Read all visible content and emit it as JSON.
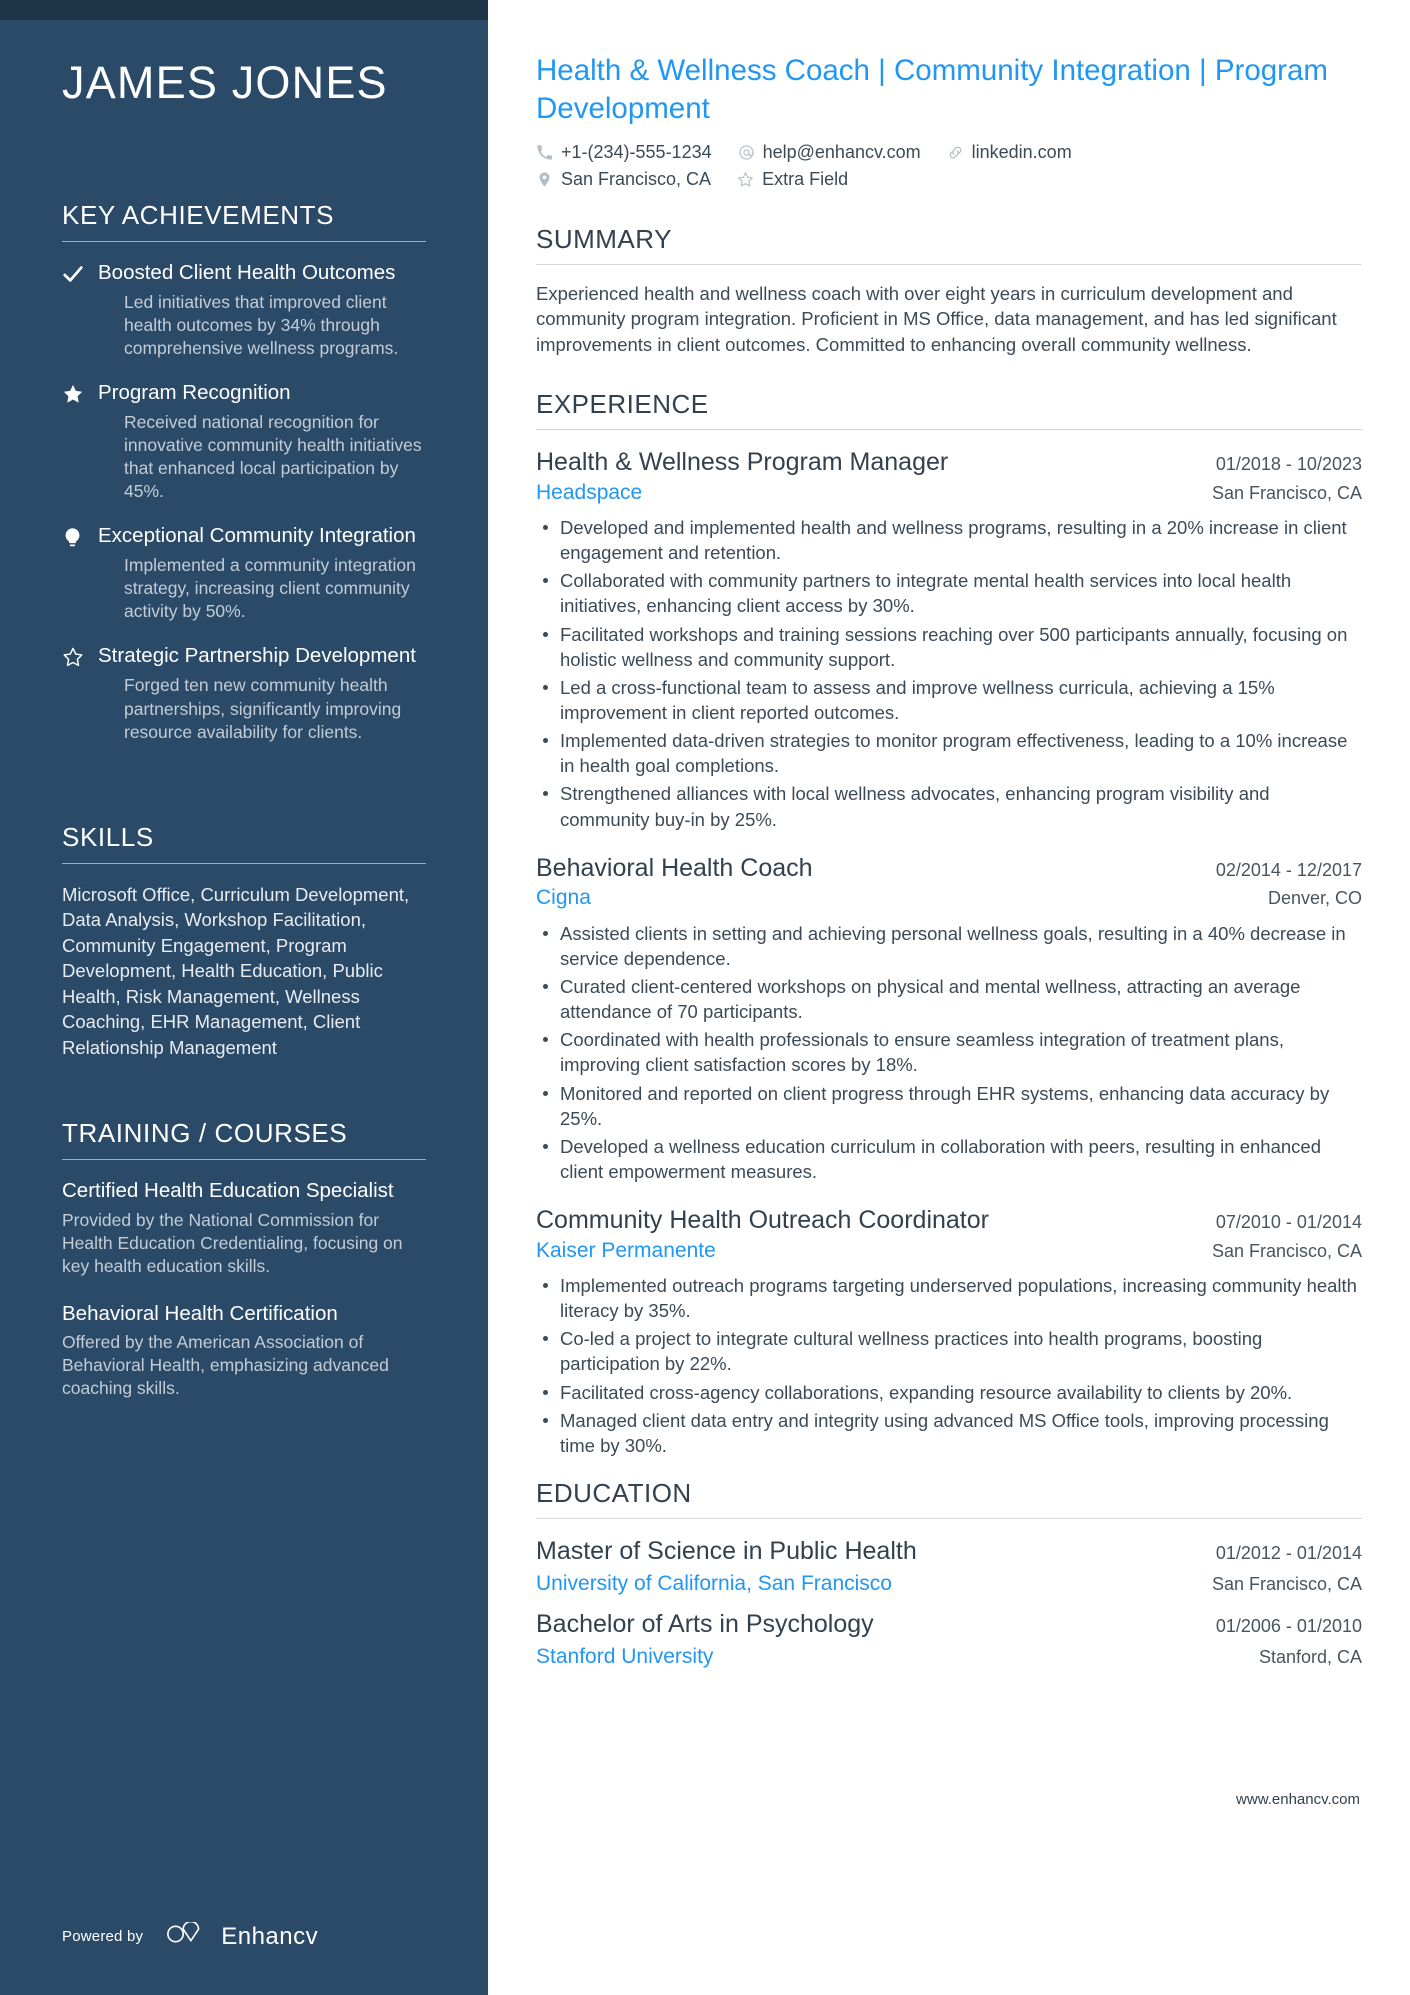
{
  "sidebar": {
    "name": "JAMES JONES",
    "sections": {
      "achievements_heading": "KEY ACHIEVEMENTS",
      "skills_heading": "SKILLS",
      "training_heading": "TRAINING / COURSES"
    },
    "achievements": [
      {
        "icon": "check-icon",
        "title": "Boosted Client Health Outcomes",
        "description": "Led initiatives that improved client health outcomes by 34% through comprehensive wellness programs."
      },
      {
        "icon": "star-filled-icon",
        "title": "Program Recognition",
        "description": "Received national recognition for innovative community health initiatives that enhanced local participation by 45%."
      },
      {
        "icon": "lightbulb-icon",
        "title": "Exceptional Community Integration",
        "description": "Implemented a community integration strategy, increasing client community activity by 50%."
      },
      {
        "icon": "star-outline-icon",
        "title": "Strategic Partnership Development",
        "description": "Forged ten new community health partnerships, significantly improving resource availability for clients."
      }
    ],
    "skills_text": "Microsoft Office, Curriculum Development, Data Analysis, Workshop Facilitation, Community Engagement, Program Development, Health Education, Public Health, Risk Management, Wellness Coaching, EHR Management, Client Relationship Management",
    "courses": [
      {
        "title": "Certified Health Education Specialist",
        "description": "Provided by the National Commission for Health Education Credentialing, focusing on key health education skills."
      },
      {
        "title": "Behavioral Health Certification",
        "description": "Offered by the American Association of Behavioral Health, emphasizing advanced coaching skills."
      }
    ],
    "footer": {
      "powered_by": "Powered by",
      "brand": "Enhancv"
    }
  },
  "main": {
    "headline": "Health & Wellness Coach | Community Integration | Program Development",
    "contacts": [
      {
        "icon": "phone-icon",
        "value": "+1-(234)-555-1234"
      },
      {
        "icon": "email-icon",
        "value": "help@enhancv.com"
      },
      {
        "icon": "link-icon",
        "value": "linkedin.com"
      },
      {
        "icon": "location-pin-icon",
        "value": "San Francisco, CA"
      },
      {
        "icon": "star-outline-icon",
        "value": "Extra Field"
      }
    ],
    "summary": {
      "heading": "SUMMARY",
      "text": "Experienced health and wellness coach with over eight years in curriculum development and community program integration. Proficient in MS Office, data management, and has led significant improvements in client outcomes. Committed to enhancing overall community wellness."
    },
    "experience": {
      "heading": "EXPERIENCE",
      "jobs": [
        {
          "title": "Health & Wellness Program Manager",
          "dates": "01/2018 - 10/2023",
          "company": "Headspace",
          "location": "San Francisco, CA",
          "bullets": [
            "Developed and implemented health and wellness programs, resulting in a 20% increase in client engagement and retention.",
            "Collaborated with community partners to integrate mental health services into local health initiatives, enhancing client access by 30%.",
            "Facilitated workshops and training sessions reaching over 500 participants annually, focusing on holistic wellness and community support.",
            "Led a cross-functional team to assess and improve wellness curricula, achieving a 15% improvement in client reported outcomes.",
            "Implemented data-driven strategies to monitor program effectiveness, leading to a 10% increase in health goal completions.",
            "Strengthened alliances with local wellness advocates, enhancing program visibility and community buy-in by 25%."
          ]
        },
        {
          "title": "Behavioral Health Coach",
          "dates": "02/2014 - 12/2017",
          "company": "Cigna",
          "location": "Denver, CO",
          "bullets": [
            "Assisted clients in setting and achieving personal wellness goals, resulting in a 40% decrease in service dependence.",
            "Curated client-centered workshops on physical and mental wellness, attracting an average attendance of 70 participants.",
            "Coordinated with health professionals to ensure seamless integration of treatment plans, improving client satisfaction scores by 18%.",
            "Monitored and reported on client progress through EHR systems, enhancing data accuracy by 25%.",
            "Developed a wellness education curriculum in collaboration with peers, resulting in enhanced client empowerment measures."
          ]
        },
        {
          "title": "Community Health Outreach Coordinator",
          "dates": "07/2010 - 01/2014",
          "company": "Kaiser Permanente",
          "location": "San Francisco, CA",
          "bullets": [
            "Implemented outreach programs targeting underserved populations, increasing community health literacy by 35%.",
            "Co-led a project to integrate cultural wellness practices into health programs, boosting participation by 22%.",
            "Facilitated cross-agency collaborations, expanding resource availability to clients by 20%.",
            "Managed client data entry and integrity using advanced MS Office tools, improving processing time by 30%."
          ]
        }
      ]
    },
    "education": {
      "heading": "EDUCATION",
      "entries": [
        {
          "degree": "Master of Science in Public Health",
          "dates": "01/2012 - 01/2014",
          "school": "University of California, San Francisco",
          "location": "San Francisco, CA"
        },
        {
          "degree": "Bachelor of Arts in Psychology",
          "dates": "01/2006 - 01/2010",
          "school": "Stanford University",
          "location": "Stanford, CA"
        }
      ]
    },
    "footer_url": "www.enhancv.com"
  },
  "colors": {
    "sidebar_bg": "#2a4a68",
    "sidebar_topbar": "#1e3549",
    "accent_blue": "#2196f3",
    "body_text": "#3c4a57"
  }
}
